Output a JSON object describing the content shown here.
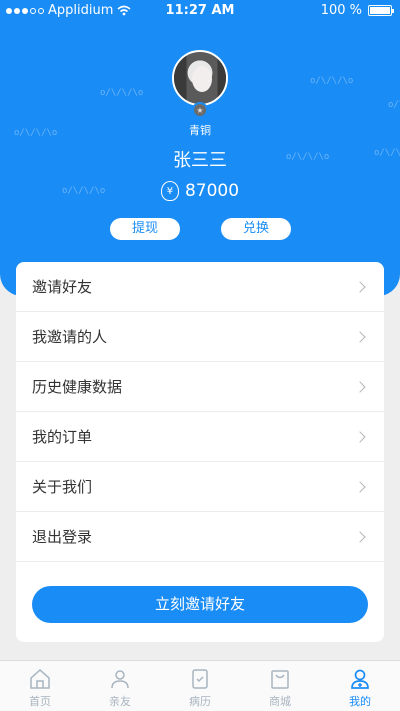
{
  "status_bar": {
    "carrier": "Applidium",
    "time": "11:27 AM",
    "battery": "100 %"
  },
  "profile": {
    "rank": "青铜",
    "name": "张三三",
    "coins": "87000",
    "withdraw_label": "提现",
    "exchange_label": "兑换"
  },
  "menu": {
    "items": [
      {
        "label": "邀请好友"
      },
      {
        "label": "我邀请的人"
      },
      {
        "label": "历史健康数据"
      },
      {
        "label": "我的订单"
      },
      {
        "label": "关于我们"
      },
      {
        "label": "退出登录"
      }
    ],
    "invite_button": "立刻邀请好友"
  },
  "tabbar": {
    "items": [
      {
        "label": "首页",
        "icon": "home-icon"
      },
      {
        "label": "亲友",
        "icon": "friends-icon"
      },
      {
        "label": "病历",
        "icon": "medical-record-icon"
      },
      {
        "label": "商城",
        "icon": "shop-icon"
      },
      {
        "label": "我的",
        "icon": "profile-icon"
      }
    ],
    "active": "我的"
  },
  "colors": {
    "primary": "#1a8cf5",
    "background": "#eeeeee"
  }
}
